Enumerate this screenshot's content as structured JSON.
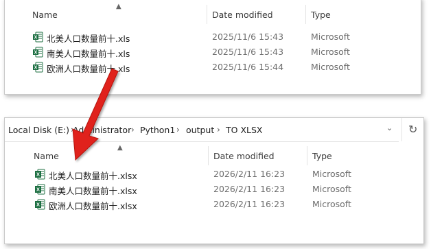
{
  "top_window": {
    "columns": {
      "name": "Name",
      "date": "Date modified",
      "type": "Type"
    },
    "files": [
      {
        "name": "北美人口数量前十.xls",
        "date": "2025/11/6 15:43",
        "type": "Microsoft"
      },
      {
        "name": "南美人口数量前十.xls",
        "date": "2025/11/6 15:43",
        "type": "Microsoft"
      },
      {
        "name": "欧洲人口数量前十.xls",
        "date": "2025/11/6 15:44",
        "type": "Microsoft"
      }
    ]
  },
  "bottom_window": {
    "breadcrumb": [
      "Local Disk (E:)",
      "Administrator",
      "Python1",
      "output",
      "TO XLSX"
    ],
    "columns": {
      "name": "Name",
      "date": "Date modified",
      "type": "Type"
    },
    "files": [
      {
        "name": "北美人口数量前十.xlsx",
        "date": "2026/2/11 16:23",
        "type": "Microsoft"
      },
      {
        "name": "南美人口数量前十.xlsx",
        "date": "2026/2/11 16:23",
        "type": "Microsoft"
      },
      {
        "name": "欧洲人口数量前十.xlsx",
        "date": "2026/2/11 16:23",
        "type": "Microsoft"
      }
    ]
  },
  "icons": {
    "file": "excel-file-icon",
    "sort": "sort-ascending-icon",
    "dropdown": "chevron-down-icon",
    "refresh": "refresh-icon",
    "crumb_sep": "chevron-right-icon",
    "arrow": "red-arrow-annotation"
  },
  "colors": {
    "excel_green": "#1d6f42",
    "arrow_red": "#e0201b"
  }
}
